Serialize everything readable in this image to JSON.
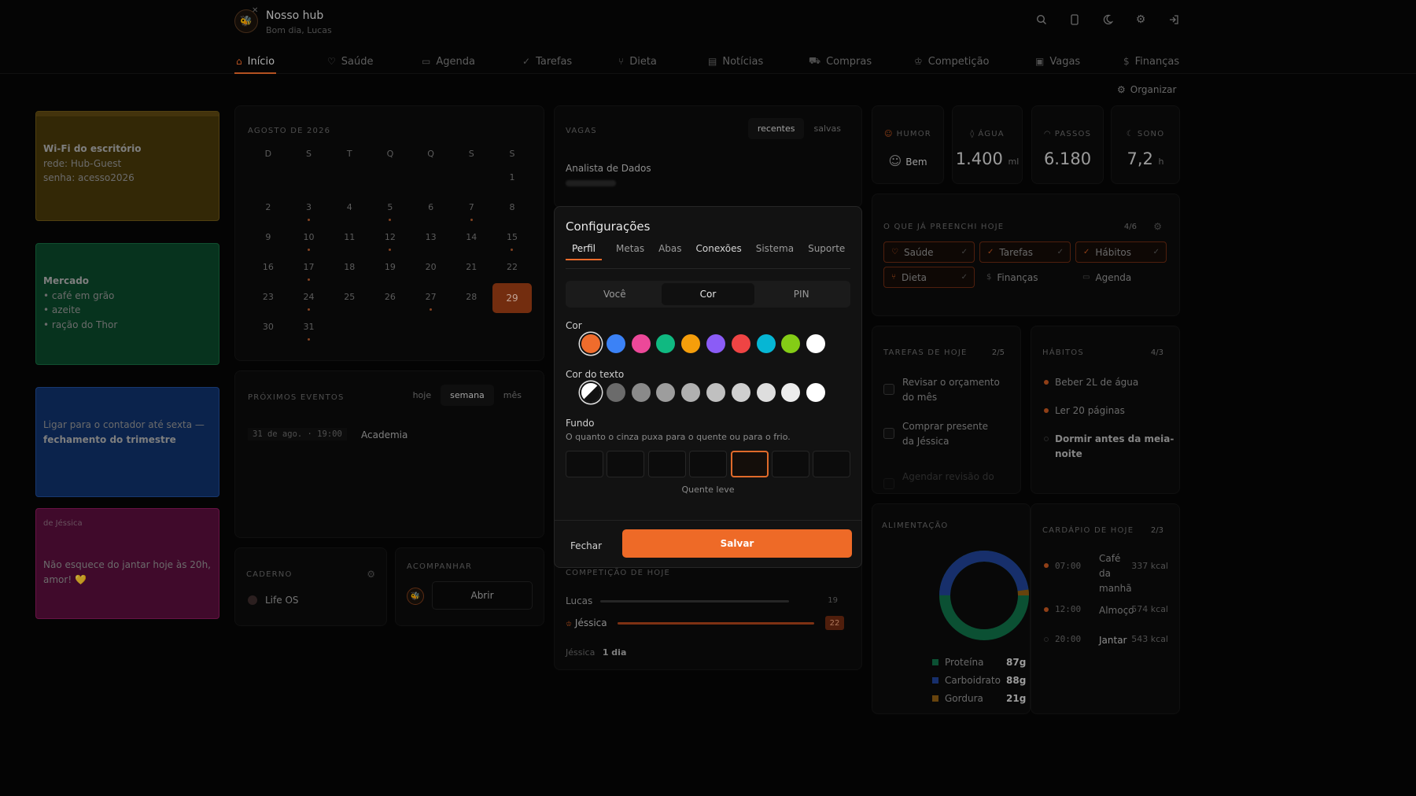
{
  "header": {
    "title": "Nosso hub",
    "subtitle": "Bom dia, Lucas",
    "avatar_icon": "bee-icon"
  },
  "nav": {
    "tabs": [
      {
        "label": "Início",
        "icon": "home-icon"
      },
      {
        "label": "Saúde",
        "icon": "heart-icon"
      },
      {
        "label": "Agenda",
        "icon": "calendar-icon"
      },
      {
        "label": "Tarefas",
        "icon": "check-icon"
      },
      {
        "label": "Dieta",
        "icon": "fork-icon"
      },
      {
        "label": "Notícias",
        "icon": "news-icon"
      },
      {
        "label": "Compras",
        "icon": "cart-icon"
      },
      {
        "label": "Competição",
        "icon": "trophy-icon"
      },
      {
        "label": "Vagas",
        "icon": "briefcase-icon"
      },
      {
        "label": "Finanças",
        "icon": "dollar-icon"
      }
    ],
    "active": "Início"
  },
  "organize_label": "Organizar",
  "notes": [
    {
      "title": "Wi-Fi do escritório",
      "lines": [
        "rede: Hub-Guest",
        "senha: acesso2026"
      ],
      "color": "#4a3a0c"
    },
    {
      "title": "Mercado",
      "lines": [
        "• café em grão",
        "• azeite",
        "• ração do Thor"
      ],
      "color": "#0b4a2c"
    },
    {
      "text": "Ligar para o contador até sexta —",
      "bold": "fechamento do trimestre",
      "color": "#10306a"
    },
    {
      "from": "de Jéssica",
      "text": "Não esquece do jantar hoje às 20h, amor! 💛",
      "color": "#5a0f3c"
    }
  ],
  "calendar": {
    "month": "AGOSTO DE 2026",
    "weekdays": [
      "D",
      "S",
      "T",
      "Q",
      "Q",
      "S",
      "S"
    ],
    "weeks": [
      [
        "",
        "",
        "",
        "",
        "",
        "",
        "1"
      ],
      [
        "2",
        "3",
        "4",
        "5",
        "6",
        "7",
        "8"
      ],
      [
        "9",
        "10",
        "11",
        "12",
        "13",
        "14",
        "15"
      ],
      [
        "16",
        "17",
        "18",
        "19",
        "20",
        "21",
        "22"
      ],
      [
        "23",
        "24",
        "25",
        "26",
        "27",
        "28",
        "29"
      ],
      [
        "30",
        "31",
        "",
        "",
        "",
        "",
        ""
      ]
    ],
    "dots": [
      "3",
      "5",
      "7",
      "10",
      "12",
      "15",
      "17",
      "24",
      "27",
      "31"
    ],
    "today": "29"
  },
  "events": {
    "title": "PRÓXIMOS EVENTOS",
    "filters": [
      "hoje",
      "semana",
      "mês"
    ],
    "active_filter": "semana",
    "items": [
      {
        "when": "31 de ago. · 19:00",
        "name": "Academia"
      }
    ]
  },
  "notebook": {
    "title": "CADERNO",
    "item": "Life OS"
  },
  "follow": {
    "title": "ACOMPANHAR",
    "button": "Abrir"
  },
  "jobs": {
    "title": "VAGAS",
    "filters": [
      "recentes",
      "salvas"
    ],
    "active": "recentes",
    "first": "Analista de Dados"
  },
  "competition": {
    "title": "COMPETIÇÃO DE HOJE",
    "rows": [
      {
        "name": "Lucas",
        "score": "19",
        "pct": 0.85
      },
      {
        "name": "Jéssica",
        "score": "22",
        "pct": 1.0
      }
    ],
    "leader": "Jéssica",
    "streak": "1 dia"
  },
  "stats": [
    {
      "label": "HUMOR",
      "value": "Bem",
      "icon": "smile-icon"
    },
    {
      "label": "ÁGUA",
      "value": "1.400",
      "unit": "ml"
    },
    {
      "label": "PASSOS",
      "value": "6.180"
    },
    {
      "label": "SONO",
      "value": "7,2",
      "unit": "h"
    }
  ],
  "filled": {
    "title": "O QUE JÁ PREENCHI HOJE",
    "count": "4/6",
    "chips": [
      "Saúde",
      "Tarefas",
      "Hábitos",
      "Dieta",
      "Finanças",
      "Agenda"
    ]
  },
  "tasks": {
    "title": "TAREFAS DE HOJE",
    "count": "2/5",
    "items": [
      "Revisar o orçamento do mês",
      "Comprar presente da Jéssica",
      "Agendar revisão do"
    ]
  },
  "habits": {
    "title": "HÁBITOS",
    "count": "4/3",
    "items": [
      "Beber 2L de água",
      "Ler 20 páginas",
      "Dormir antes da meia-noite"
    ]
  },
  "food": {
    "title": "ALIMENTAÇÃO",
    "macros": [
      {
        "name": "Proteína",
        "g": "87g",
        "color": "#0f6b45"
      },
      {
        "name": "Carboidrato",
        "g": "88g",
        "color": "#1f3f8f"
      },
      {
        "name": "Gordura",
        "g": "21g",
        "color": "#8a5a12"
      }
    ]
  },
  "menu": {
    "title": "CARDÁPIO DE HOJE",
    "count": "2/3",
    "items": [
      {
        "time": "07:00",
        "name": "Café da manhã",
        "kcal": "337 kcal"
      },
      {
        "time": "12:00",
        "name": "Almoço",
        "kcal": "574 kcal"
      },
      {
        "time": "20:00",
        "name": "Jantar",
        "kcal": "543 kcal"
      }
    ]
  },
  "modal": {
    "title": "Configurações",
    "tabs": [
      "Perfil",
      "Metas",
      "Abas",
      "Conexões",
      "Sistema",
      "Suporte"
    ],
    "active_tab": "Perfil",
    "segments": [
      "Você",
      "Cor",
      "PIN"
    ],
    "active_segment": "Cor",
    "color_label": "Cor",
    "colors": [
      "#ef6c2c",
      "#3b82f6",
      "#ec4899",
      "#10b981",
      "#f59e0b",
      "#8b5cf6",
      "#ef4444",
      "#06b6d4",
      "#84cc16",
      "#ffffff"
    ],
    "text_color_label": "Cor do texto",
    "text_colors": [
      "#ffffff",
      "#6b6b6b",
      "#8a8a8a",
      "#9d9d9d",
      "#b0b0b0",
      "#c0c0c0",
      "#cfcfcf",
      "#dedede",
      "#ececec",
      "#ffffff"
    ],
    "bg_label": "Fundo",
    "bg_desc": "O quanto o cinza puxa para o quente ou para o frio.",
    "bg_selected": "Quente leve",
    "close": "Fechar",
    "save": "Salvar"
  }
}
